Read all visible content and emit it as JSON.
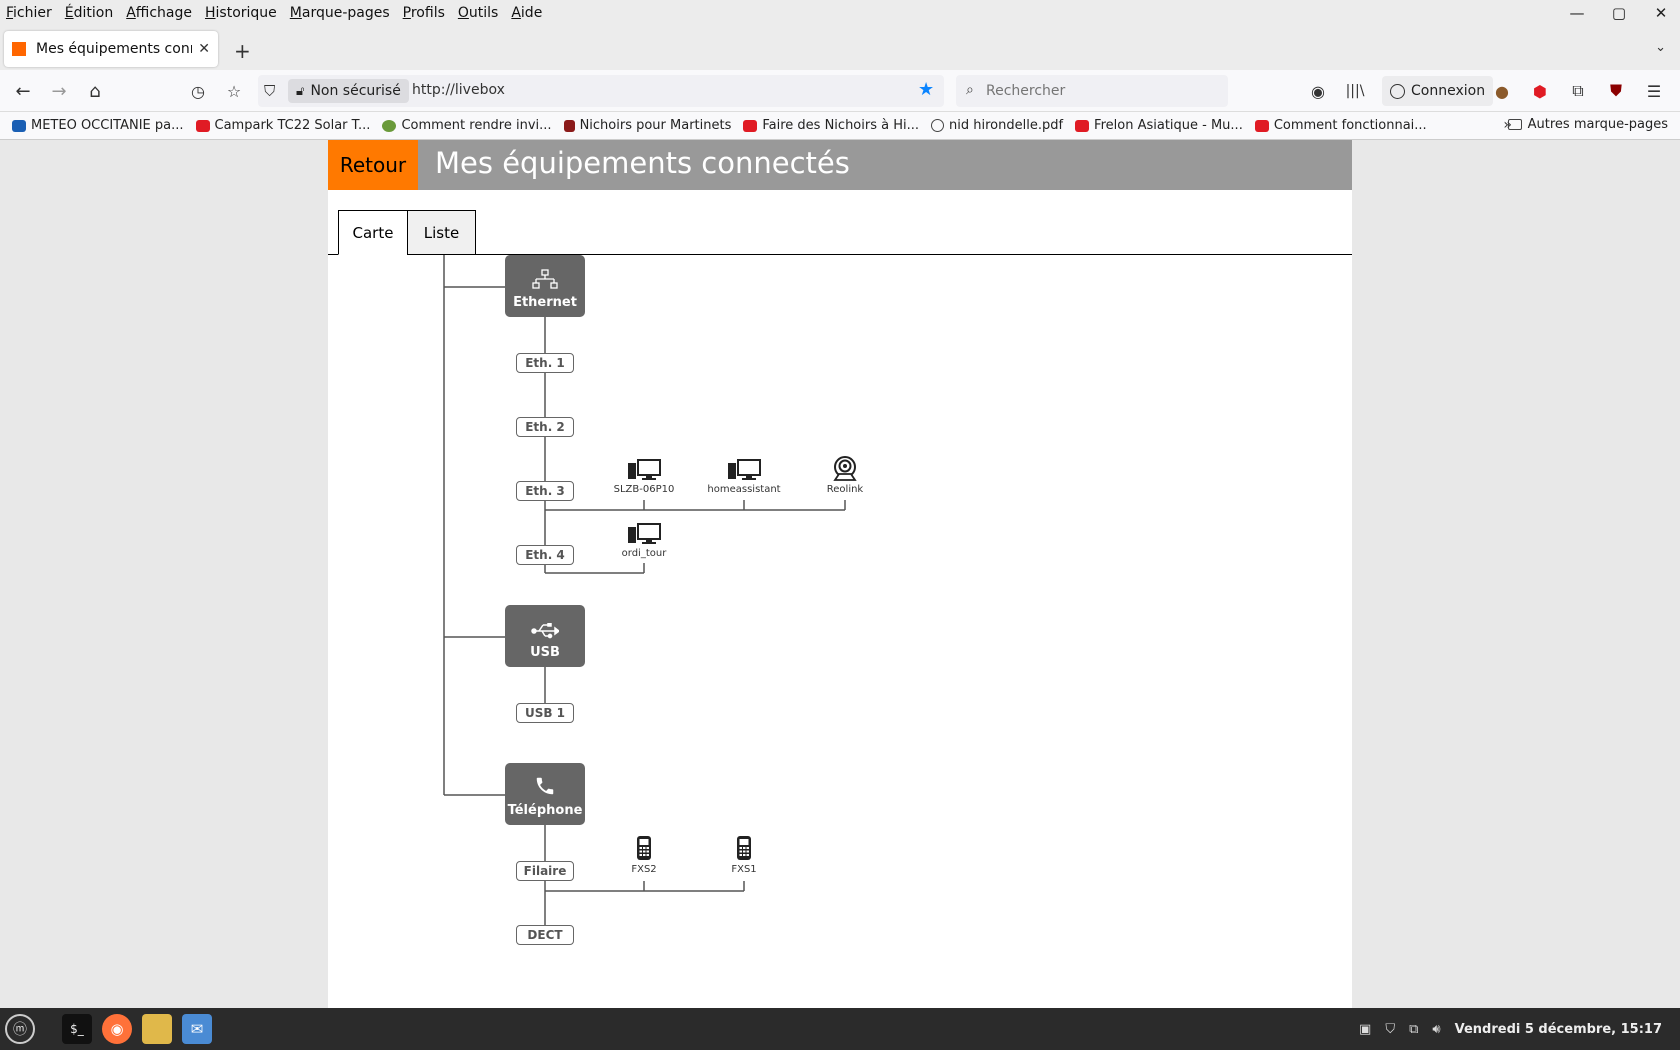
{
  "menu": [
    "Fichier",
    "Édition",
    "Affichage",
    "Historique",
    "Marque-pages",
    "Profils",
    "Outils",
    "Aide"
  ],
  "tab": {
    "title": "Mes équipements connectés"
  },
  "nav": {
    "insecure_label": "Non sécurisé",
    "url": "http://livebox",
    "search_placeholder": "Rechercher",
    "connexion_label": "Connexion"
  },
  "bookmarks": [
    {
      "label": "METEO OCCITANIE pa...",
      "color": "#1a5fb4"
    },
    {
      "label": "Campark TC22 Solar T...",
      "color": "#e01b24"
    },
    {
      "label": "Comment rendre invi...",
      "color": "#6a9a3a"
    },
    {
      "label": "Nichoirs pour Martinets",
      "color": "#8b1a1a"
    },
    {
      "label": "Faire des Nichoirs à Hi...",
      "color": "#e01b24"
    },
    {
      "label": "nid hirondelle.pdf",
      "color": "#444444"
    },
    {
      "label": "Frelon Asiatique - Mu...",
      "color": "#e01b24"
    },
    {
      "label": "Comment fonctionnai...",
      "color": "#e01b24"
    }
  ],
  "bookmarks_other": "Autres marque-pages",
  "page": {
    "back_label": "Retour",
    "title": "Mes équipements connectés",
    "tabs": [
      "Carte",
      "Liste"
    ],
    "colors": {
      "accent": "#ff7900",
      "header": "#999999",
      "hub": "#666666"
    }
  },
  "map": {
    "hubs": [
      {
        "label": "Ethernet",
        "icon": "network-icon"
      },
      {
        "label": "USB",
        "icon": "usb-icon"
      },
      {
        "label": "Téléphone",
        "icon": "phone-icon"
      }
    ],
    "ports": [
      "Eth. 1",
      "Eth. 2",
      "Eth. 3",
      "Eth. 4",
      "USB 1",
      "Filaire",
      "DECT"
    ],
    "devices": [
      {
        "label": "SLZB-06P10",
        "icon": "computer-icon",
        "port": "Eth. 3"
      },
      {
        "label": "homeassistant",
        "icon": "computer-icon",
        "port": "Eth. 3"
      },
      {
        "label": "Reolink",
        "icon": "camera-icon",
        "port": "Eth. 3"
      },
      {
        "label": "ordi_tour",
        "icon": "computer-icon",
        "port": "Eth. 4"
      },
      {
        "label": "FXS2",
        "icon": "handset-icon",
        "port": "Filaire"
      },
      {
        "label": "FXS1",
        "icon": "handset-icon",
        "port": "Filaire"
      }
    ]
  },
  "taskbar": {
    "clock": "Vendredi  5 décembre, 15:17"
  }
}
